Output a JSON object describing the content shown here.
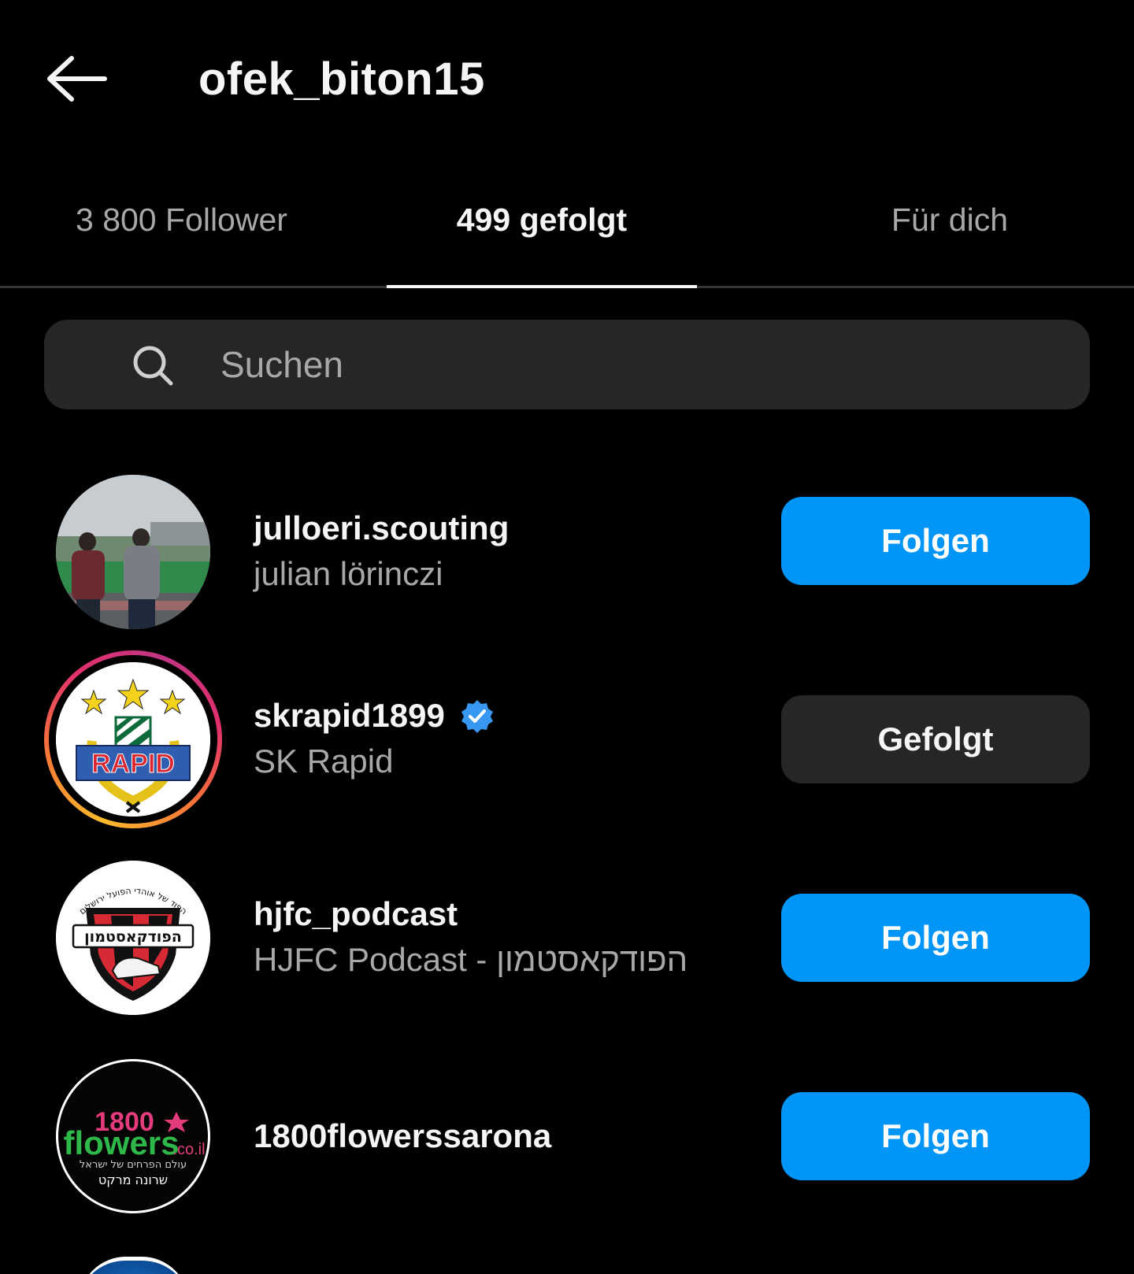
{
  "header": {
    "back_icon": "arrow-left-icon",
    "username": "ofek_biton15"
  },
  "tabs": [
    {
      "label": "3 800 Follower",
      "active": false
    },
    {
      "label": "499 gefolgt",
      "active": true
    },
    {
      "label": "Für dich",
      "active": false
    }
  ],
  "search": {
    "icon": "search-icon",
    "placeholder": "Suchen",
    "value": ""
  },
  "accounts": [
    {
      "handle": "julloeri.scouting",
      "name": "julian lörinczi",
      "verified": false,
      "button": "Folgen",
      "following": false
    },
    {
      "handle": "skrapid1899",
      "name": "SK Rapid",
      "verified": true,
      "button": "Gefolgt",
      "following": true,
      "has_story": true,
      "logo_text": "RAPID"
    },
    {
      "handle": "hjfc_podcast",
      "name": "HJFC Podcast - הפודקאסטמון",
      "verified": false,
      "button": "Folgen",
      "following": false,
      "logo_text": "הפודקאסטמון",
      "logo_arc_text": "הפוד של אוהדי הפועל ירושלים"
    },
    {
      "handle": "1800flowerssarona",
      "name": "",
      "verified": false,
      "button": "Folgen",
      "following": false,
      "logo_text": {
        "number": "1800",
        "word": "flowers",
        "tld": ".co.il",
        "tagline": "עולם הפרחים של ישראל",
        "branch": "שרונה מרקט"
      }
    }
  ],
  "colors": {
    "background": "#000000",
    "follow_button": "#0095f6",
    "following_button": "#262626",
    "verified_badge": "#3897f0",
    "secondary_text": "#a8a8a8"
  }
}
